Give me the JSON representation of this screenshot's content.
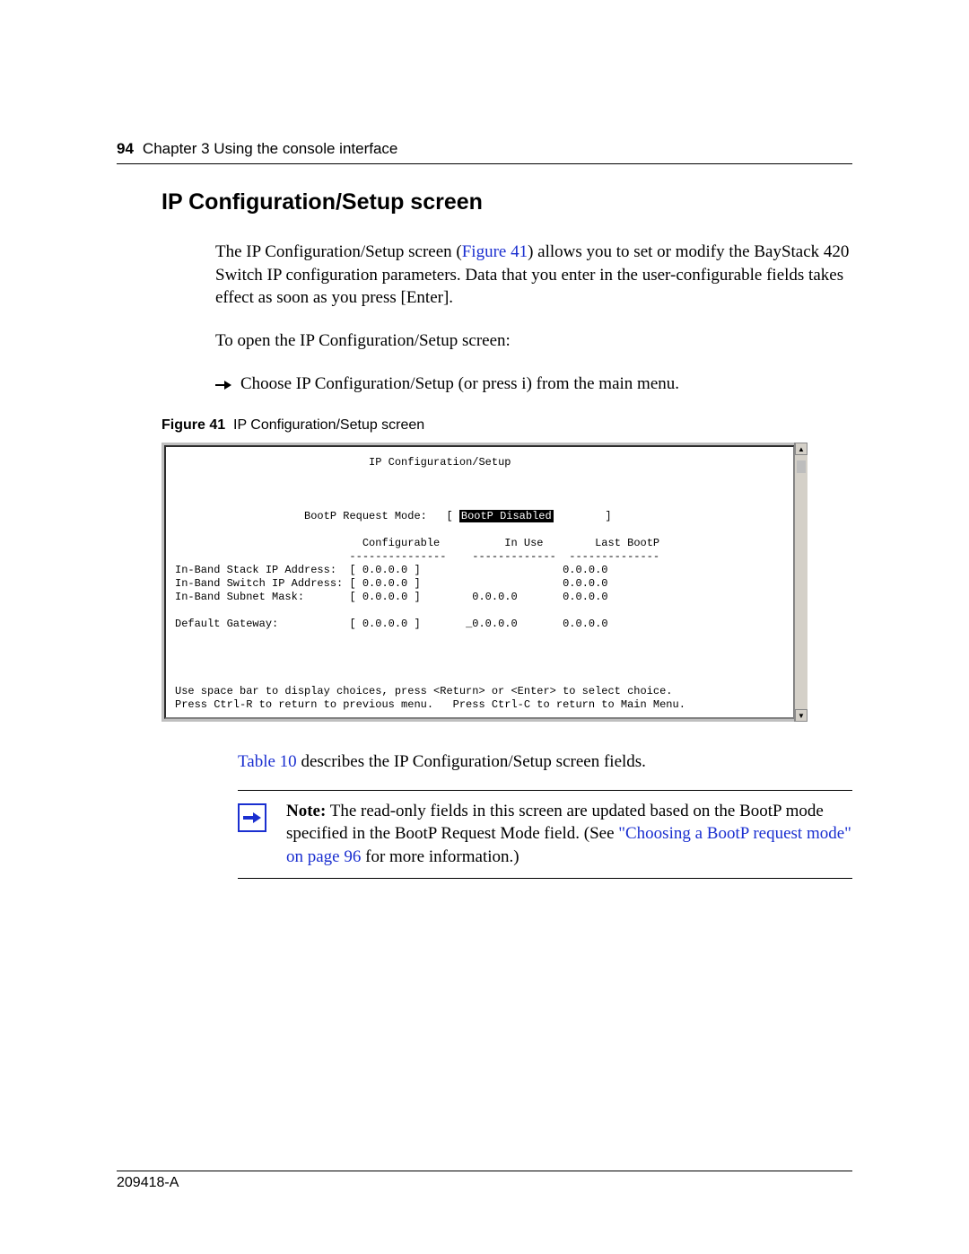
{
  "header": {
    "page_number": "94",
    "chapter": "Chapter 3  Using the console interface"
  },
  "section_title": "IP Configuration/Setup screen",
  "intro": {
    "p1a": "The IP Configuration/Setup screen (",
    "figref": "Figure 41",
    "p1b": ") allows you to set or modify the BayStack 420 Switch IP configuration parameters. Data that you enter in the user-configurable fields takes effect as soon as you press [Enter].",
    "p2": "To open the IP Configuration/Setup screen:",
    "bullet": "Choose IP Configuration/Setup (or press i) from the main menu."
  },
  "figure": {
    "label": "Figure 41",
    "caption": "IP Configuration/Setup screen"
  },
  "console": {
    "title": "IP Configuration/Setup",
    "bootp_label": "BootP Request Mode:",
    "bootp_value": "BootP Disabled",
    "cols": {
      "c1": "Configurable",
      "c2": "In Use",
      "c3": "Last BootP"
    },
    "rows": [
      {
        "label": "In-Band Stack IP Address:",
        "conf": "[ 0.0.0.0 ]",
        "inuse": "",
        "last": "0.0.0.0"
      },
      {
        "label": "In-Band Switch IP Address:",
        "conf": "[ 0.0.0.0 ]",
        "inuse": "",
        "last": "0.0.0.0"
      },
      {
        "label": "In-Band Subnet Mask:",
        "conf": "[ 0.0.0.0 ]",
        "inuse": "0.0.0.0",
        "last": "0.0.0.0"
      },
      {
        "label": "Default Gateway:",
        "conf": "[ 0.0.0.0 ]",
        "inuse": "_0.0.0.0",
        "last": "0.0.0.0"
      }
    ],
    "help1": "Use space bar to display choices, press <Return> or <Enter> to select choice.",
    "help2": "Press Ctrl-R to return to previous menu.   Press Ctrl-C to return to Main Menu."
  },
  "after_fig": {
    "tref": "Table 10",
    "rest": " describes the IP Configuration/Setup screen fields."
  },
  "note": {
    "label": "Note:",
    "t1": " The read-only fields in this screen are updated based on the BootP mode specified in the BootP Request Mode field. (See ",
    "link": "\"Choosing a BootP request mode\" on page 96",
    "t2": " for more information.)"
  },
  "footer": {
    "doc": "209418-A"
  }
}
